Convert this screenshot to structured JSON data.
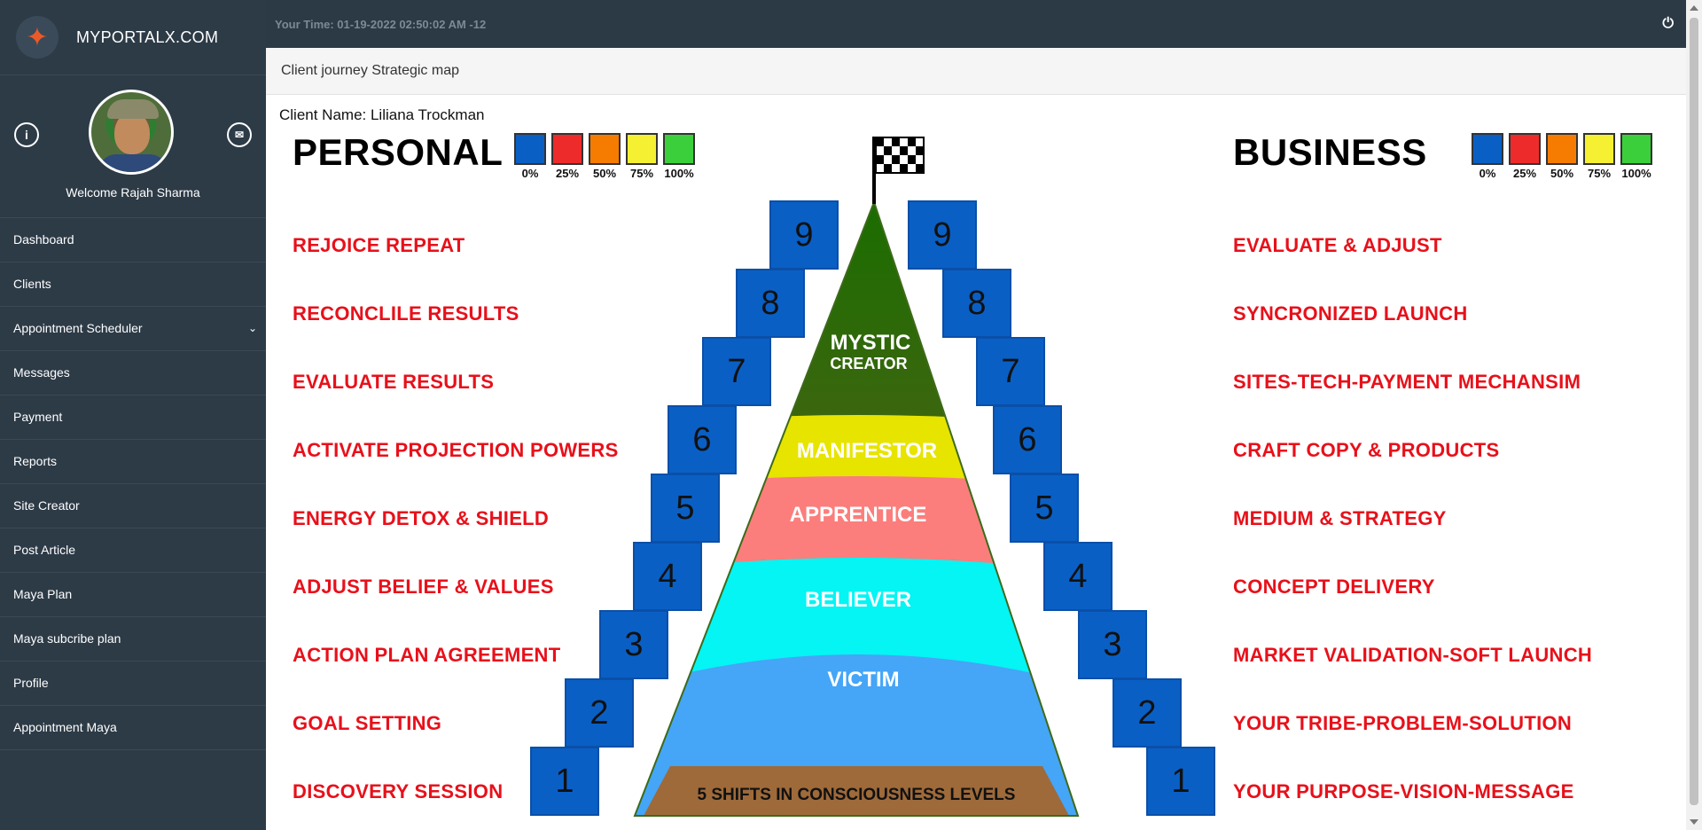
{
  "brand": {
    "name": "MYPORTALX.COM",
    "logo_icon": "dancer-logo-icon"
  },
  "user": {
    "welcome": "Welcome Rajah Sharma"
  },
  "sidebar": {
    "items": [
      {
        "label": "Dashboard"
      },
      {
        "label": "Clients"
      },
      {
        "label": "Appointment Scheduler",
        "has_submenu": true
      },
      {
        "label": "Messages"
      },
      {
        "label": "Payment"
      },
      {
        "label": "Reports"
      },
      {
        "label": "Site Creator"
      },
      {
        "label": "Post Article"
      },
      {
        "label": "Maya Plan"
      },
      {
        "label": "Maya subcribe plan"
      },
      {
        "label": "Profile"
      },
      {
        "label": "Appointment Maya"
      }
    ]
  },
  "topbar": {
    "time": "Your Time: 01-19-2022 02:50:02 AM -12"
  },
  "page": {
    "title": "Client journey Strategic map",
    "client_name": "Client Name: Liliana Trockman"
  },
  "legend": [
    {
      "label": "0%",
      "color": "#0a5fc4"
    },
    {
      "label": "25%",
      "color": "#ee2b2b"
    },
    {
      "label": "50%",
      "color": "#f57c00"
    },
    {
      "label": "75%",
      "color": "#f5f032"
    },
    {
      "label": "100%",
      "color": "#3ccf3c"
    }
  ],
  "personal": {
    "title": "PERSONAL",
    "steps": [
      {
        "number": "9",
        "label": "REJOICE REPEAT"
      },
      {
        "number": "8",
        "label": "RECONCLILE RESULTS"
      },
      {
        "number": "7",
        "label": "EVALUATE RESULTS"
      },
      {
        "number": "6",
        "label": "ACTIVATE PROJECTION POWERS"
      },
      {
        "number": "5",
        "label": "ENERGY DETOX & SHIELD"
      },
      {
        "number": "4",
        "label": "ADJUST BELIEF & VALUES"
      },
      {
        "number": "3",
        "label": "ACTION PLAN AGREEMENT"
      },
      {
        "number": "2",
        "label": "GOAL SETTING"
      },
      {
        "number": "1",
        "label": "DISCOVERY SESSION"
      }
    ]
  },
  "business": {
    "title": "BUSINESS",
    "steps": [
      {
        "number": "9",
        "label": "EVALUATE & ADJUST"
      },
      {
        "number": "8",
        "label": "SYNCRONIZED LAUNCH"
      },
      {
        "number": "7",
        "label": "SITES-TECH-PAYMENT MECHANSIM"
      },
      {
        "number": "6",
        "label": "CRAFT COPY & PRODUCTS"
      },
      {
        "number": "5",
        "label": "MEDIUM & STRATEGY"
      },
      {
        "number": "4",
        "label": "CONCEPT DELIVERY"
      },
      {
        "number": "3",
        "label": "MARKET VALIDATION-SOFT LAUNCH"
      },
      {
        "number": "2",
        "label": "YOUR TRIBE-PROBLEM-SOLUTION"
      },
      {
        "number": "1",
        "label": "YOUR PURPOSE-VISION-MESSAGE"
      }
    ]
  },
  "pyramid": {
    "levels": {
      "mystic": "MYSTIC",
      "creator": "CREATOR",
      "manifestor": "MANIFESTOR",
      "apprentice": "APPRENTICE",
      "believer": "BELIEVER",
      "victim": "VICTIM"
    },
    "base_label": "5 SHIFTS IN CONSCIOUSNESS LEVELS",
    "flag_icon": "checkered-flag-icon"
  }
}
